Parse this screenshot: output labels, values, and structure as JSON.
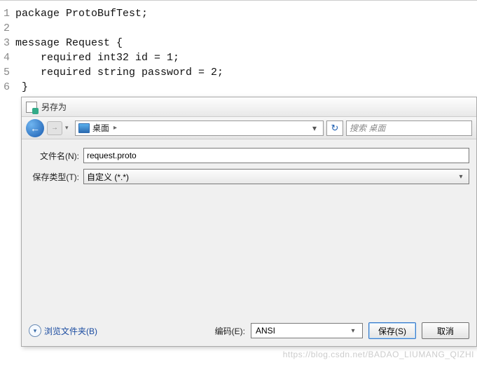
{
  "code": {
    "lines": [
      {
        "n": "1",
        "t": "package ProtoBufTest;"
      },
      {
        "n": "2",
        "t": ""
      },
      {
        "n": "3",
        "t": "message Request {"
      },
      {
        "n": "4",
        "t": "    required int32 id = 1;"
      },
      {
        "n": "5",
        "t": "    required string password = 2;"
      },
      {
        "n": "6",
        "t": " }"
      }
    ]
  },
  "dialog": {
    "title": "另存为",
    "close": "✕",
    "nav": {
      "location_label": "桌面",
      "arrow": "▸",
      "dropdown": "▾",
      "refresh": "↻",
      "search_placeholder": "搜索 桌面"
    },
    "filename_label": "文件名(N):",
    "filename_value": "request.proto",
    "filetype_label": "保存类型(T):",
    "filetype_value": "自定义 (*.*)",
    "browse_folders": "浏览文件夹(B)",
    "encoding_label": "编码(E):",
    "encoding_value": "ANSI",
    "save_btn": "保存(S)",
    "cancel_btn": "取消"
  },
  "watermark": "https://blog.csdn.net/BADAO_LIUMANG_QIZHI"
}
